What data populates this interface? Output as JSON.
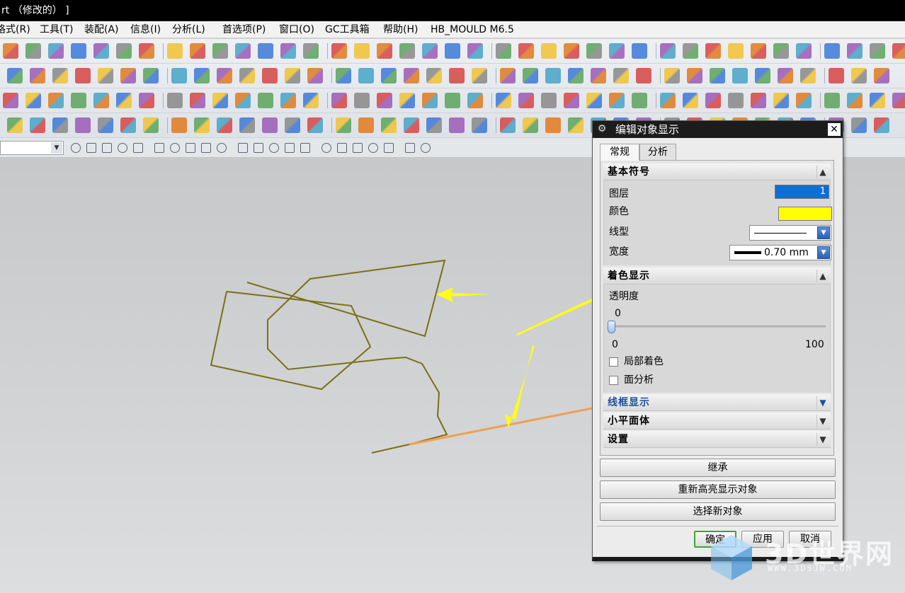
{
  "window": {
    "title": "rt （修改的） ]"
  },
  "menu": [
    "格式(R)",
    "工具(T)",
    "装配(A)",
    "信息(I)",
    "分析(L)",
    "首选项(P)",
    "窗口(O)",
    "GC工具箱",
    "帮助(H)",
    "HB_MOULD M6.5"
  ],
  "dialog": {
    "title": "编辑对象显示",
    "tabs": [
      "常规",
      "分析"
    ],
    "active_tab": "常规",
    "sections": {
      "basic": {
        "title": "基本符号",
        "layer_label": "图层",
        "layer_value": "1",
        "color_label": "颜色",
        "color_value": "#ffff00",
        "linetype_label": "线型",
        "width_label": "宽度",
        "width_value": "0.70 mm"
      },
      "shading": {
        "title": "着色显示",
        "transparency_label": "透明度",
        "transparency_value": "0",
        "slider_min": "0",
        "slider_max": "100",
        "partial_shading_label": "局部着色",
        "face_analysis_label": "面分析"
      },
      "wireframe": {
        "title": "线框显示"
      },
      "facets": {
        "title": "小平面体"
      },
      "settings": {
        "title": "设置"
      }
    },
    "buttons": {
      "inherit": "继承",
      "reselect": "重新高亮显示对象",
      "select_new": "选择新对象",
      "ok": "确定",
      "apply": "应用",
      "cancel": "取消"
    }
  },
  "watermark": {
    "brand": "3D世界网",
    "url": "WWW.3DSJW.COM"
  },
  "colors": {
    "curve": "#7a7014",
    "highlight_curve": "#f0a050",
    "arrow": "#ffff10",
    "accent_blue": "#0b6fd3"
  }
}
